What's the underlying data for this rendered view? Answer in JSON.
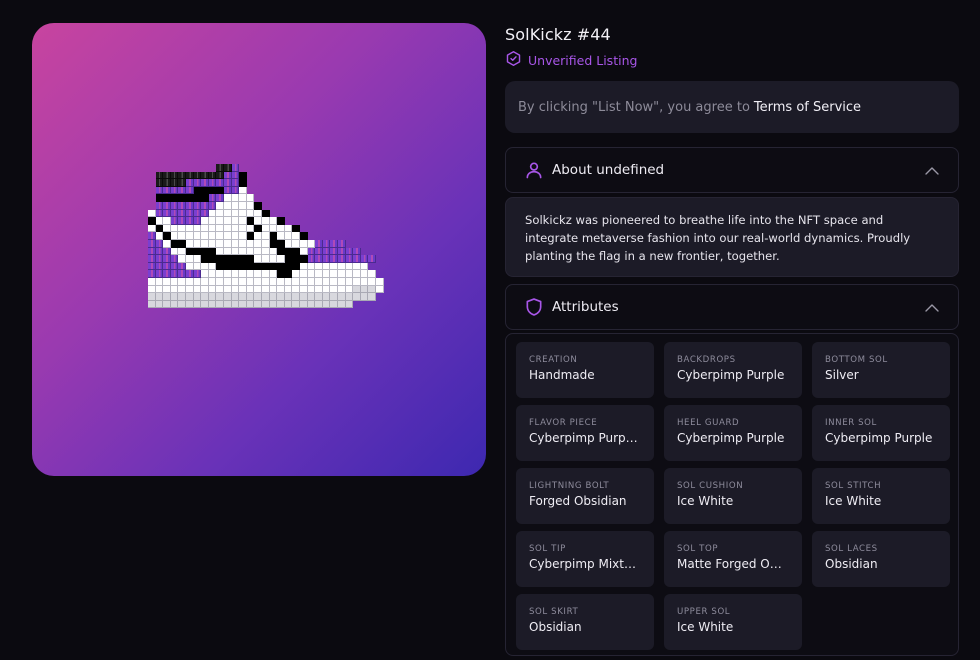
{
  "nft": {
    "title": "SolKickz #44",
    "verification_status": "Unverified Listing",
    "verification_icon": "shield-check-icon"
  },
  "terms": {
    "text": "By clicking \"List Now\", you agree to",
    "link_label": "Terms of Service"
  },
  "about": {
    "heading": "About undefined",
    "icon": "user-icon",
    "expanded": true,
    "description": "Solkickz was pioneered to breathe life into the NFT space and integrate metaverse fashion into our real-world dynamics. Proudly planting the flag in a new frontier, together."
  },
  "attributes": {
    "heading": "Attributes",
    "icon": "shield-icon",
    "expanded": true,
    "items": [
      {
        "label": "Creation",
        "value": "Handmade"
      },
      {
        "label": "Backdrops",
        "value": "Cyberpimp Purple"
      },
      {
        "label": "Bottom Sol",
        "value": "Silver"
      },
      {
        "label": "Flavor Piece",
        "value": "Cyberpimp Purple ..."
      },
      {
        "label": "Heel Guard",
        "value": "Cyberpimp Purple"
      },
      {
        "label": "Inner Sol",
        "value": "Cyberpimp Purple"
      },
      {
        "label": "Lightning Bolt",
        "value": "Forged Obsidian"
      },
      {
        "label": "Sol Cushion",
        "value": "Ice White"
      },
      {
        "label": "Sol Stitch",
        "value": "Ice White"
      },
      {
        "label": "Sol Tip",
        "value": "Cyberpimp Mixture"
      },
      {
        "label": "Sol Top",
        "value": "Matte Forged Obsi..."
      },
      {
        "label": "Sol Laces",
        "value": "Obsidian"
      },
      {
        "label": "Sol Skirt",
        "value": "Obsidian"
      },
      {
        "label": "Upper Sol",
        "value": "Ice White"
      }
    ]
  },
  "colors": {
    "accent": "#a856e8",
    "background": "#0b0a10",
    "card": "#1c1b27",
    "gradient_start": "#c8449f",
    "gradient_end": "#3d28b0"
  }
}
